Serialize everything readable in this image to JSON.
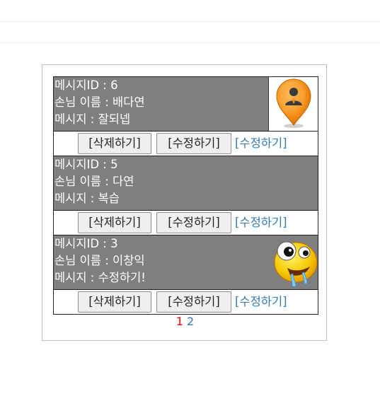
{
  "guestbook": {
    "entries": [
      {
        "id_label": "메시지ID : 6",
        "name_label": "손님 이름 : 배다연",
        "message_label": "메시지 : 잘되넵",
        "avatar": "map-pin-person-icon",
        "delete_label": "[삭제하기]",
        "edit_button_label": "[수정하기]",
        "edit_link_label": "[수정하기]"
      },
      {
        "id_label": "메시지ID : 5",
        "name_label": "손님 이름 : 다연",
        "message_label": "메시지 : 복습",
        "avatar": "",
        "delete_label": "[삭제하기]",
        "edit_button_label": "[수정하기]",
        "edit_link_label": "[수정하기]"
      },
      {
        "id_label": "메시지ID : 3",
        "name_label": "손님 이름 : 이창익",
        "message_label": "메시지 : 수정하기!",
        "avatar": "drooling-emoji-icon",
        "delete_label": "[삭제하기]",
        "edit_button_label": "[수정하기]",
        "edit_link_label": "[수정하기]"
      }
    ],
    "pagination": {
      "current_page": "1",
      "pages": [
        "2"
      ]
    }
  },
  "colors": {
    "entry_bg": "#7f7f7f",
    "link": "#337ab7",
    "current_page": "#ff0000"
  }
}
